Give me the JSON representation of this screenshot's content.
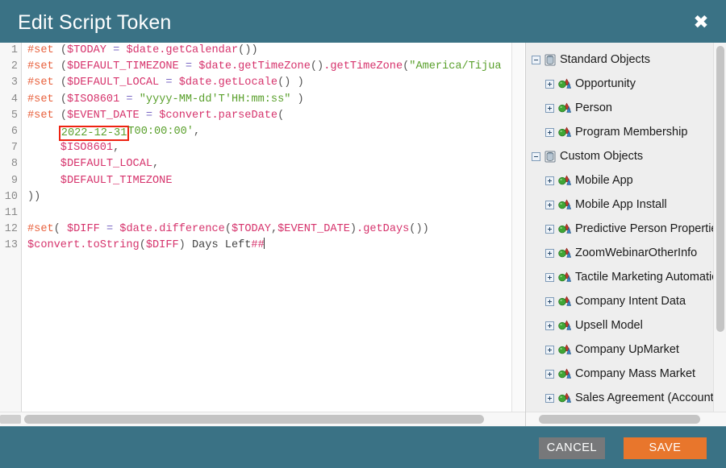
{
  "dialog": {
    "title": "Edit Script Token",
    "close_icon": "close-icon"
  },
  "editor": {
    "line_numbers": [
      "1",
      "2",
      "3",
      "4",
      "5",
      "6",
      "7",
      "8",
      "9",
      "10",
      "11",
      "12",
      "13"
    ],
    "lines": [
      {
        "n": 1,
        "segments": [
          {
            "t": "#set",
            "c": "dir"
          },
          {
            "t": " ",
            "c": "plain"
          },
          {
            "t": "(",
            "c": "paren"
          },
          {
            "t": "$TODAY",
            "c": "var"
          },
          {
            "t": " ",
            "c": "plain"
          },
          {
            "t": "=",
            "c": "op"
          },
          {
            "t": " ",
            "c": "plain"
          },
          {
            "t": "$date",
            "c": "var"
          },
          {
            "t": ".getCalendar",
            "c": "var"
          },
          {
            "t": "())",
            "c": "paren"
          }
        ]
      },
      {
        "n": 2,
        "segments": [
          {
            "t": "#set",
            "c": "dir"
          },
          {
            "t": " ",
            "c": "plain"
          },
          {
            "t": "(",
            "c": "paren"
          },
          {
            "t": "$DEFAULT_TIMEZONE",
            "c": "var"
          },
          {
            "t": " ",
            "c": "plain"
          },
          {
            "t": "=",
            "c": "op"
          },
          {
            "t": " ",
            "c": "plain"
          },
          {
            "t": "$date",
            "c": "var"
          },
          {
            "t": ".getTimeZone",
            "c": "var"
          },
          {
            "t": "()",
            "c": "paren"
          },
          {
            "t": ".getTimeZone",
            "c": "var"
          },
          {
            "t": "(",
            "c": "paren"
          },
          {
            "t": "\"America/Tijua",
            "c": "str"
          }
        ]
      },
      {
        "n": 3,
        "segments": [
          {
            "t": "#set",
            "c": "dir"
          },
          {
            "t": " ",
            "c": "plain"
          },
          {
            "t": "(",
            "c": "paren"
          },
          {
            "t": "$DEFAULT_LOCAL",
            "c": "var"
          },
          {
            "t": " ",
            "c": "plain"
          },
          {
            "t": "=",
            "c": "op"
          },
          {
            "t": " ",
            "c": "plain"
          },
          {
            "t": "$date",
            "c": "var"
          },
          {
            "t": ".getLocale",
            "c": "var"
          },
          {
            "t": "() )",
            "c": "paren"
          }
        ]
      },
      {
        "n": 4,
        "segments": [
          {
            "t": "#set",
            "c": "dir"
          },
          {
            "t": " ",
            "c": "plain"
          },
          {
            "t": "(",
            "c": "paren"
          },
          {
            "t": "$ISO8601",
            "c": "var"
          },
          {
            "t": " ",
            "c": "plain"
          },
          {
            "t": "=",
            "c": "op"
          },
          {
            "t": " ",
            "c": "plain"
          },
          {
            "t": "\"yyyy-MM-dd'T'HH:mm:ss\"",
            "c": "str"
          },
          {
            "t": " )",
            "c": "paren"
          }
        ]
      },
      {
        "n": 5,
        "segments": [
          {
            "t": "#set",
            "c": "dir"
          },
          {
            "t": " ",
            "c": "plain"
          },
          {
            "t": "(",
            "c": "paren"
          },
          {
            "t": "$EVENT_DATE",
            "c": "var"
          },
          {
            "t": " ",
            "c": "plain"
          },
          {
            "t": "=",
            "c": "op"
          },
          {
            "t": " ",
            "c": "plain"
          },
          {
            "t": "$convert",
            "c": "var"
          },
          {
            "t": ".parseDate",
            "c": "var"
          },
          {
            "t": "(",
            "c": "paren"
          }
        ]
      },
      {
        "n": 6,
        "highlight_text": "2022-12-31",
        "segments": [
          {
            "t": "     ",
            "c": "plain"
          },
          {
            "t": "2022-12-31",
            "c": "str",
            "box": true
          },
          {
            "t": "T00:00:00'",
            "c": "str"
          },
          {
            "t": ",",
            "c": "paren"
          }
        ]
      },
      {
        "n": 7,
        "segments": [
          {
            "t": "     ",
            "c": "plain"
          },
          {
            "t": "$ISO8601",
            "c": "var"
          },
          {
            "t": ",",
            "c": "paren"
          }
        ]
      },
      {
        "n": 8,
        "segments": [
          {
            "t": "     ",
            "c": "plain"
          },
          {
            "t": "$DEFAULT_LOCAL",
            "c": "var"
          },
          {
            "t": ",",
            "c": "paren"
          }
        ]
      },
      {
        "n": 9,
        "segments": [
          {
            "t": "     ",
            "c": "plain"
          },
          {
            "t": "$DEFAULT_TIMEZONE",
            "c": "var"
          }
        ]
      },
      {
        "n": 10,
        "segments": [
          {
            "t": "))",
            "c": "paren"
          }
        ]
      },
      {
        "n": 11,
        "segments": [
          {
            "t": "",
            "c": "plain"
          }
        ]
      },
      {
        "n": 12,
        "segments": [
          {
            "t": "#set",
            "c": "dir"
          },
          {
            "t": "(",
            "c": "paren"
          },
          {
            "t": " ",
            "c": "plain"
          },
          {
            "t": "$DIFF",
            "c": "var"
          },
          {
            "t": " ",
            "c": "plain"
          },
          {
            "t": "=",
            "c": "op"
          },
          {
            "t": " ",
            "c": "plain"
          },
          {
            "t": "$date",
            "c": "var"
          },
          {
            "t": ".difference",
            "c": "var"
          },
          {
            "t": "(",
            "c": "paren"
          },
          {
            "t": "$TODAY",
            "c": "var"
          },
          {
            "t": ",",
            "c": "paren"
          },
          {
            "t": "$EVENT_DATE",
            "c": "var"
          },
          {
            "t": ")",
            "c": "paren"
          },
          {
            "t": ".getDays",
            "c": "var"
          },
          {
            "t": "())",
            "c": "paren"
          }
        ]
      },
      {
        "n": 13,
        "caret": true,
        "segments": [
          {
            "t": "$convert",
            "c": "var"
          },
          {
            "t": ".toString",
            "c": "var"
          },
          {
            "t": "(",
            "c": "paren"
          },
          {
            "t": "$DIFF",
            "c": "var"
          },
          {
            "t": ")",
            "c": "paren"
          },
          {
            "t": " Days ",
            "c": "plain"
          },
          {
            "t": "Left",
            "c": "plain"
          },
          {
            "t": "##",
            "c": "var"
          }
        ]
      }
    ],
    "full_text_lines": [
      "#set ($TODAY = $date.getCalendar())",
      "#set ($DEFAULT_TIMEZONE = $date.getTimeZone().getTimeZone(\"America/Tijua",
      "#set ($DEFAULT_LOCAL = $date.getLocale() )",
      "#set ($ISO8601 = \"yyyy-MM-dd'T'HH:mm:ss\" )",
      "#set ($EVENT_DATE = $convert.parseDate(",
      "     '2022-12-31T00:00:00',",
      "     $ISO8601,",
      "     $DEFAULT_LOCAL,",
      "     $DEFAULT_TIMEZONE",
      "))",
      "",
      "#set( $DIFF = $date.difference($TODAY,$EVENT_DATE).getDays())",
      "$convert.toString($DIFF) Days Left##"
    ],
    "highlight_color": "#ee2211"
  },
  "tree": {
    "nodes": [
      {
        "label": "Standard Objects",
        "level": 0,
        "toggle": "minus",
        "icon": "database-icon"
      },
      {
        "label": "Opportunity",
        "level": 1,
        "toggle": "plus",
        "icon": "object-shapes-icon"
      },
      {
        "label": "Person",
        "level": 1,
        "toggle": "plus",
        "icon": "object-shapes-icon"
      },
      {
        "label": "Program Membership",
        "level": 1,
        "toggle": "plus",
        "icon": "object-shapes-icon"
      },
      {
        "label": "Custom Objects",
        "level": 0,
        "toggle": "minus",
        "icon": "database-icon"
      },
      {
        "label": "Mobile App",
        "level": 1,
        "toggle": "plus",
        "icon": "object-shapes-icon"
      },
      {
        "label": "Mobile App Install",
        "level": 1,
        "toggle": "plus",
        "icon": "object-shapes-icon"
      },
      {
        "label": "Predictive Person Properties",
        "level": 1,
        "toggle": "plus",
        "icon": "object-shapes-icon"
      },
      {
        "label": "ZoomWebinarOtherInfo",
        "level": 1,
        "toggle": "plus",
        "icon": "object-shapes-icon"
      },
      {
        "label": "Tactile Marketing Automation",
        "level": 1,
        "toggle": "plus",
        "icon": "object-shapes-icon"
      },
      {
        "label": "Company Intent Data",
        "level": 1,
        "toggle": "plus",
        "icon": "object-shapes-icon"
      },
      {
        "label": "Upsell Model",
        "level": 1,
        "toggle": "plus",
        "icon": "object-shapes-icon"
      },
      {
        "label": "Company UpMarket",
        "level": 1,
        "toggle": "plus",
        "icon": "object-shapes-icon"
      },
      {
        "label": "Company Mass Market",
        "level": 1,
        "toggle": "plus",
        "icon": "object-shapes-icon"
      },
      {
        "label": "Sales Agreement (Account)",
        "level": 1,
        "toggle": "plus",
        "icon": "object-shapes-icon"
      }
    ]
  },
  "footer": {
    "cancel_label": "CANCEL",
    "save_label": "SAVE",
    "cancel_color": "#77787a",
    "save_color": "#e8762c"
  },
  "theme": {
    "chrome": "#3a7285",
    "panel_bg": "#eeeeee",
    "editor_bg": "#ffffff"
  }
}
